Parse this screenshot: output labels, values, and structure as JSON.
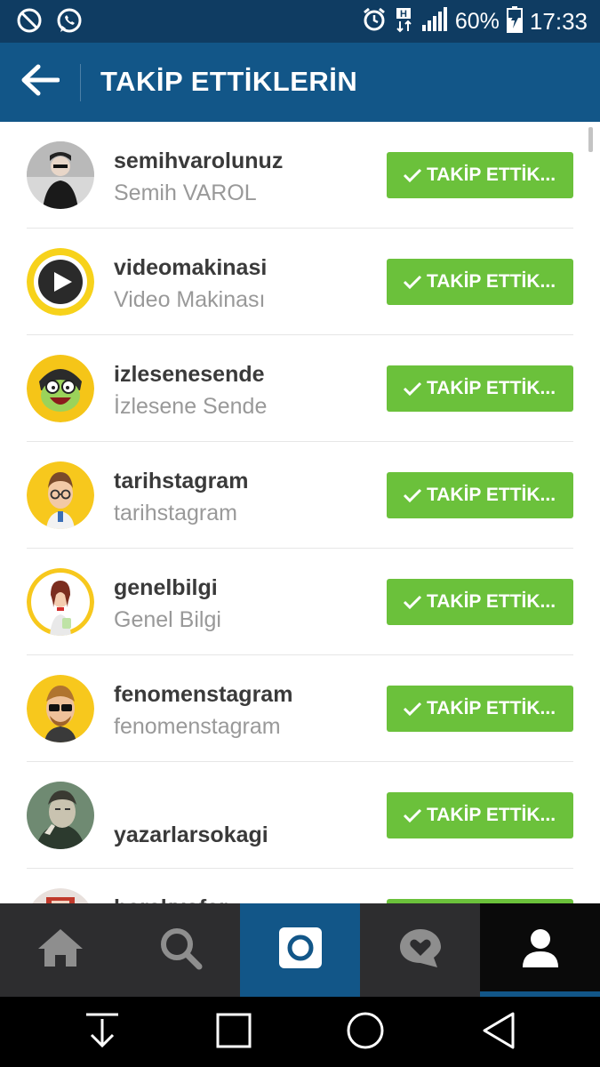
{
  "status_bar": {
    "battery": "60%",
    "time": "17:33",
    "icons": [
      "block-icon",
      "whatsapp-icon",
      "alarm-icon",
      "hspa-data-icon",
      "signal-icon",
      "battery-charging-icon"
    ]
  },
  "header": {
    "title": "TAKİP ETTİKLERİN",
    "back_icon": "arrow-left-icon"
  },
  "follow_button_label": "TAKİP ETTİK...",
  "users": [
    {
      "username": "semihvarolunuz",
      "fullname": "Semih VAROL"
    },
    {
      "username": "videomakinasi",
      "fullname": "Video Makinası"
    },
    {
      "username": "izlesenesende",
      "fullname": "İzlesene Sende"
    },
    {
      "username": "tarihstagram",
      "fullname": "tarihstagram"
    },
    {
      "username": "genelbilgi",
      "fullname": "Genel Bilgi"
    },
    {
      "username": "fenomenstagram",
      "fullname": "fenomenstagram"
    },
    {
      "username": "yazarlarsokagi",
      "fullname": ""
    },
    {
      "username": "harakyofar",
      "fullname": ""
    }
  ],
  "tabs": [
    {
      "name": "home",
      "icon": "home-icon"
    },
    {
      "name": "search",
      "icon": "search-icon"
    },
    {
      "name": "camera",
      "icon": "camera-icon"
    },
    {
      "name": "activity",
      "icon": "heart-bubble-icon"
    },
    {
      "name": "profile",
      "icon": "person-icon",
      "active": true
    }
  ],
  "nav_bar": [
    "download-icon",
    "recents-icon",
    "home-circle-icon",
    "back-triangle-icon"
  ],
  "colors": {
    "status_bar": "#0f3c62",
    "header": "#125688",
    "follow_button": "#6bc13b",
    "tab_bar": "#2d2d2f",
    "tab_active": "#125688"
  }
}
